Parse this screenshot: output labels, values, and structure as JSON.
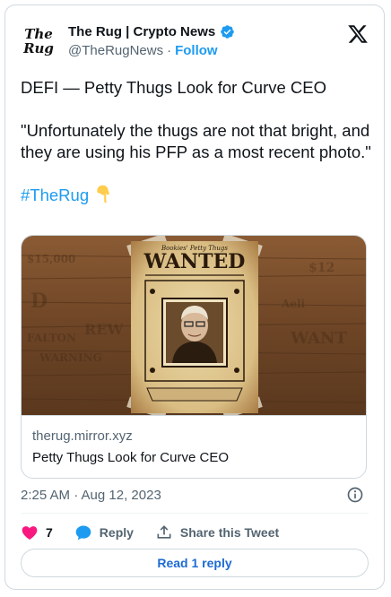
{
  "header": {
    "avatar_line1": "The",
    "avatar_line2": "Rug",
    "display_name": "The Rug | Crypto News",
    "handle": "@TheRugNews",
    "separator": "·",
    "follow_label": "Follow"
  },
  "tweet": {
    "line1": "DEFI — Petty Thugs Look for Curve CEO",
    "line2": "\"Unfortunately the thugs are not that bright, and they are using his PFP as a most recent photo.\"",
    "hashtag": "#TheRug"
  },
  "link_card": {
    "poster_small": "Bookies' Petty Thugs",
    "poster_title": "WANTED",
    "domain": "therug.mirror.xyz",
    "title": "Petty Thugs Look for Curve CEO"
  },
  "timestamp": "2:25 AM · Aug 12, 2023",
  "actions": {
    "like_count": "7",
    "reply_label": "Reply",
    "share_label": "Share this Tweet"
  },
  "read_reply_label": "Read 1 reply",
  "colors": {
    "accent": "#1d9bf0",
    "like": "#f91880",
    "text": "#0f1419",
    "secondary": "#536471"
  }
}
